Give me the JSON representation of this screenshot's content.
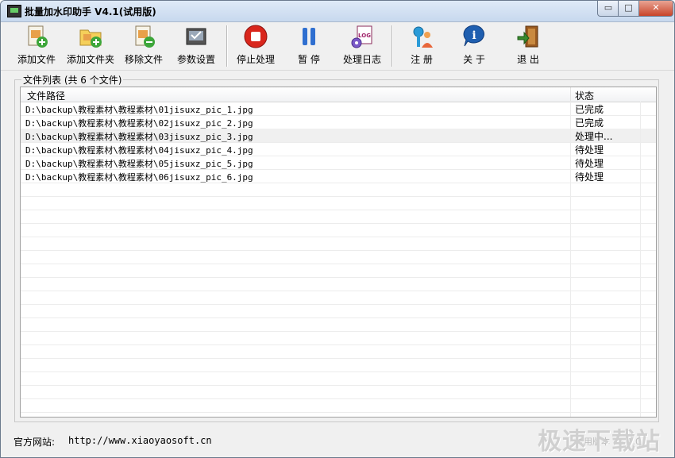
{
  "window": {
    "title": "批量加水印助手 V4.1(试用版)",
    "controls": {
      "minimize": "▭",
      "maximize": "□",
      "close": "✕"
    }
  },
  "toolbar": {
    "add_file": "添加文件",
    "add_folder": "添加文件夹",
    "remove_file": "移除文件",
    "settings": "参数设置",
    "stop": "停止处理",
    "pause": "暂 停",
    "log": "处理日志",
    "register": "注 册",
    "about": "关 于",
    "exit": "退 出",
    "log_icon_text": "LOG",
    "info_icon_text": "i"
  },
  "file_list": {
    "group_label": "文件列表 (共 6 个文件)",
    "columns": {
      "path": "文件路径",
      "status": "状态"
    },
    "rows": [
      {
        "path": "D:\\backup\\教程素材\\教程素材\\01jisuxz_pic_1.jpg",
        "status": "已完成"
      },
      {
        "path": "D:\\backup\\教程素材\\教程素材\\02jisuxz_pic_2.jpg",
        "status": "已完成"
      },
      {
        "path": "D:\\backup\\教程素材\\教程素材\\03jisuxz_pic_3.jpg",
        "status": "处理中..."
      },
      {
        "path": "D:\\backup\\教程素材\\教程素材\\04jisuxz_pic_4.jpg",
        "status": "待处理"
      },
      {
        "path": "D:\\backup\\教程素材\\教程素材\\05jisuxz_pic_5.jpg",
        "status": "待处理"
      },
      {
        "path": "D:\\backup\\教程素材\\教程素材\\06jisuxz_pic_6.jpg",
        "status": "待处理"
      }
    ]
  },
  "footer": {
    "site_label": "官方网站:",
    "site_url": "http://www.xiaoyaosoft.cn",
    "version_text": "试用版本 V4.1.0"
  },
  "watermark": {
    "text": "极速下载站"
  },
  "colors": {
    "stop_red": "#d9261c",
    "pause_blue": "#2f6fd0",
    "exit_green": "#3a8a2e"
  }
}
